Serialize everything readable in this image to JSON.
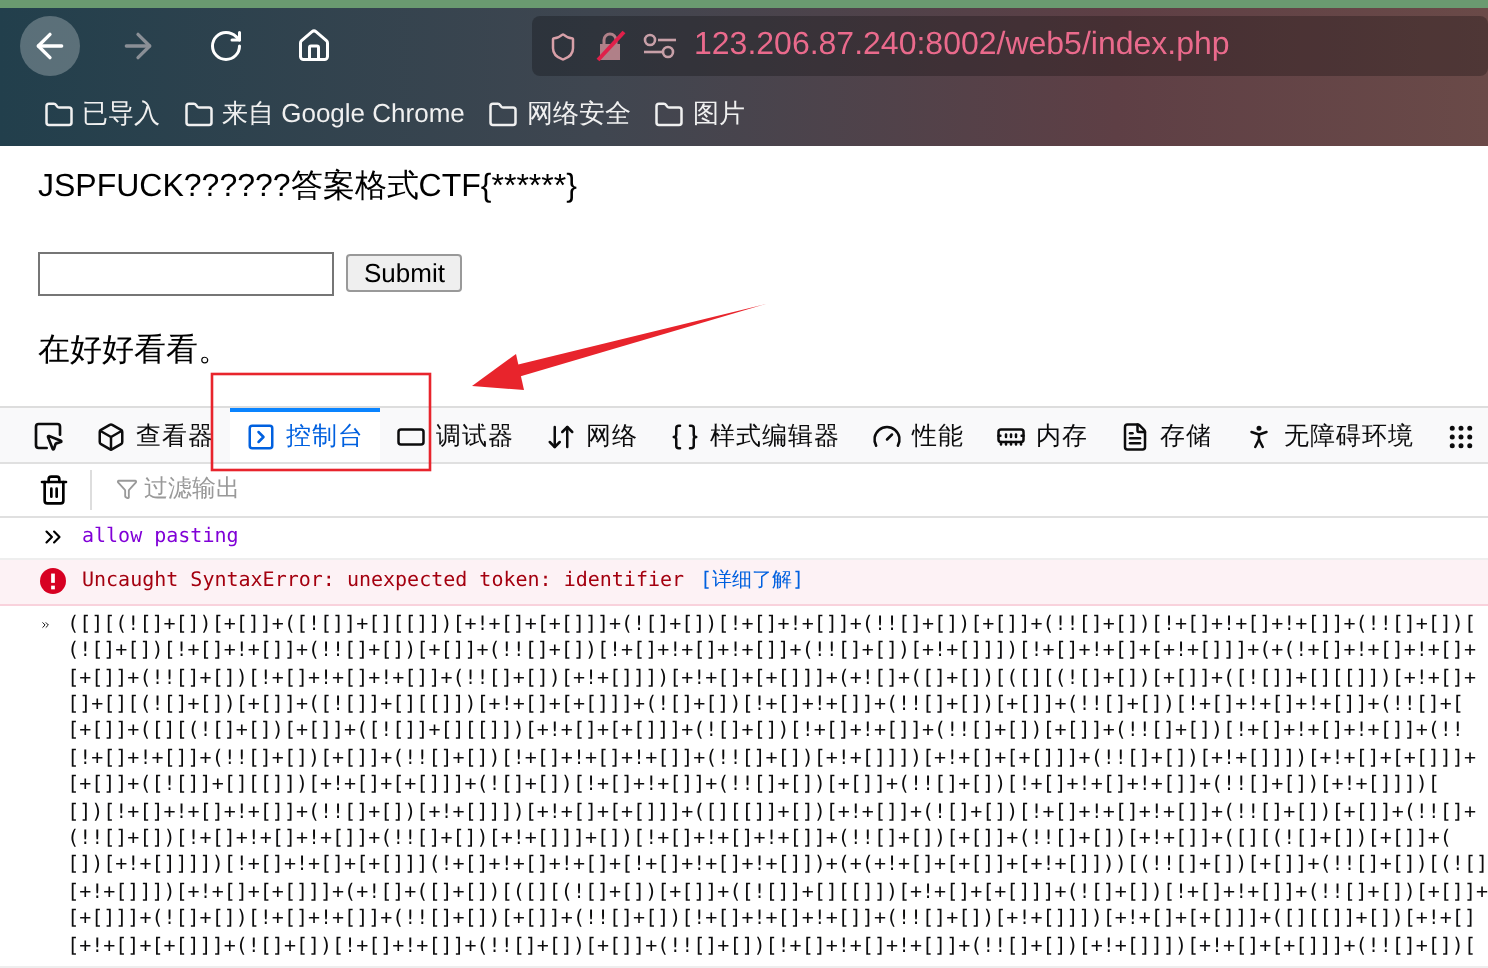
{
  "browser": {
    "url": "123.206.87.240:8002/web5/index.php",
    "bookmarks": [
      "已导入",
      "来自 Google Chrome",
      "网络安全",
      "图片"
    ]
  },
  "page": {
    "heading": "JSPFUCK??????答案格式CTF{******}",
    "submit": "Submit",
    "message": "在好好看看。"
  },
  "devtools": {
    "tabs": [
      {
        "kind": "inspector",
        "label": "查看器",
        "selected": false
      },
      {
        "kind": "console",
        "label": "控制台",
        "selected": true
      },
      {
        "kind": "debugger",
        "label": "调试器",
        "selected": false
      },
      {
        "kind": "network",
        "label": "网络",
        "selected": false
      },
      {
        "kind": "style",
        "label": "样式编辑器",
        "selected": false
      },
      {
        "kind": "performance",
        "label": "性能",
        "selected": false
      },
      {
        "kind": "memory",
        "label": "内存",
        "selected": false
      },
      {
        "kind": "storage",
        "label": "存储",
        "selected": false
      },
      {
        "kind": "accessibility",
        "label": "无障碍环境",
        "selected": false
      },
      {
        "kind": "more",
        "selected": false
      }
    ],
    "filter_placeholder": "过滤输出",
    "console": [
      {
        "kind": "input",
        "lines": [
          "allow pasting"
        ]
      },
      {
        "kind": "error",
        "text": "Uncaught SyntaxError: unexpected token: identifier",
        "link": "[详细了解]"
      },
      {
        "kind": "code",
        "lines": [
          "([][(![]+[])[+[]]+([![]]+[][[]])[+!+[]+[+[]]]+(![]+[])[!+[]+!+[]]+(!![]+[])[+[]]+(!![]+[])[!+[]+!+[]+!+[]]+(!![]+[])[",
          "(![]+[])[!+[]+!+[]]+(!![]+[])[+[]]+(!![]+[])[!+[]+!+[]+!+[]]+(!![]+[])[+!+[]]])[!+[]+!+[]+[+!+[]]]+(+(!+[]+!+[]+!+[]+",
          "[+[]]+(!![]+[])[!+[]+!+[]+!+[]]+(!![]+[])[+!+[]]])[+!+[]+[+[]]]+(+![]+([]+[])[([][(![]+[])[+[]]+([![]]+[][[]])[+!+[]+",
          "[]+[][(![]+[])[+[]]+([![]]+[][[]])[+!+[]+[+[]]]+(![]+[])[!+[]+!+[]]+(!![]+[])[+[]]+(!![]+[])[!+[]+!+[]+!+[]]+(!![]+[",
          "[+[]]+([][(![]+[])[+[]]+([![]]+[][[]])[+!+[]+[+[]]]+(![]+[])[!+[]+!+[]]+(!![]+[])[+[]]+(!![]+[])[!+[]+!+[]+!+[]]+(!!",
          "[!+[]+!+[]]+(!![]+[])[+[]]+(!![]+[])[!+[]+!+[]+!+[]]+(!![]+[])[+!+[]]])[+!+[]+[+[]]]+(!![]+[])[+!+[]]])[+!+[]+[+[]]]+",
          "[+[]]+([![]]+[][[]])[+!+[]+[+[]]]+(![]+[])[!+[]+!+[]]+(!![]+[])[+[]]+(!![]+[])[!+[]+!+[]+!+[]]+(!![]+[])[+!+[]]])[",
          "[])[!+[]+!+[]+!+[]]+(!![]+[])[+!+[]]])[+!+[]+[+[]]]+([][[]]+[])[+!+[]]+(![]+[])[!+[]+!+[]+!+[]]+(!![]+[])[+[]]+(!![]+",
          "(!![]+[])[!+[]+!+[]+!+[]]+(!![]+[])[+!+[]]]+[])[!+[]+!+[]+!+[]]+(!![]+[])[+[]]+(!![]+[])[+!+[]]+([][(![]+[])[+[]]+(",
          "[])[+!+[]]]])[!+[]+!+[]+[+[]]](!+[]+!+[]+!+[]+[!+[]+!+[]+!+[]])+(+(+!+[]+[+[]]+[+!+[]]))[(!![]+[])[+[]]+(!![]+[])[(![]",
          "[+!+[]]])[+!+[]+[+[]]]+(+![]+([]+[])[([][(![]+[])[+[]]+([![]]+[][[]])[+!+[]+[+[]]]+(![]+[])[!+[]+!+[]]+(!![]+[])[+[]]+",
          "[+[]]]+(![]+[])[!+[]+!+[]]+(!![]+[])[+[]]+(!![]+[])[!+[]+!+[]+!+[]]+(!![]+[])[+!+[]]])[+!+[]+[+[]]]+([][[]]+[])[+!+[]",
          "[+!+[]+[+[]]]+(![]+[])[!+[]+!+[]]+(!![]+[])[+[]]+(!![]+[])[!+[]+!+[]+!+[]]+(!![]+[])[+!+[]]])[+!+[]+[+[]]]+(!![]+[])["
        ]
      }
    ]
  }
}
